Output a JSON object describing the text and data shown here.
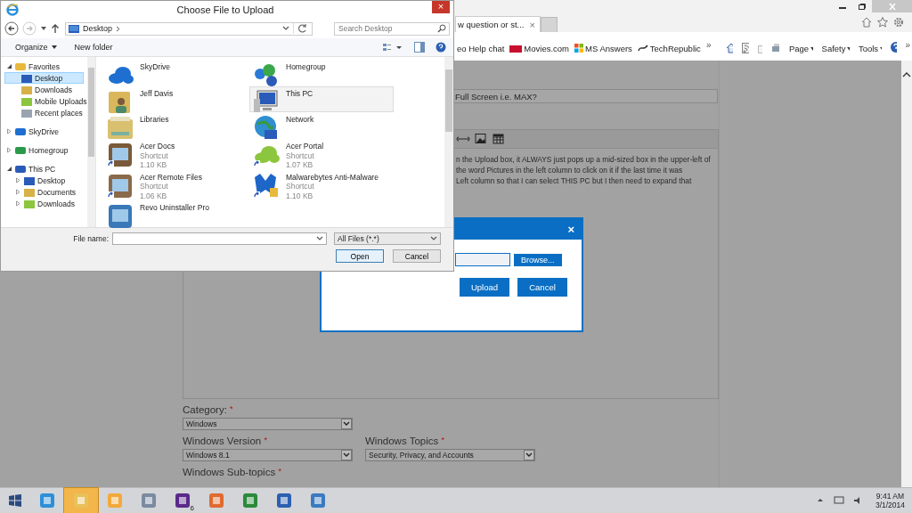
{
  "browser": {
    "tab": {
      "title": "w question or st...",
      "close": "×"
    },
    "favorites": [
      "eo Help chat",
      "Movies.com",
      "MS Answers",
      "TechRepublic"
    ],
    "overflow": "»",
    "commands": [
      "Page",
      "Safety",
      "Tools"
    ],
    "end_overflow": "»"
  },
  "page": {
    "title_value": "Full Screen i.e. MAX?",
    "body_lines": [
      "n the Upload box, it ALWAYS just pops up a mid-sized box in the upper-left of",
      "the word Pictures in the left column to click on it if the last time it was",
      "Left column so that I can select THIS PC but I then need to expand that"
    ],
    "category": {
      "label": "Category:",
      "required": "*",
      "value": "Windows"
    },
    "version": {
      "label": "Windows Version",
      "required": "*",
      "value": "Windows 8.1"
    },
    "topics": {
      "label": "Windows Topics",
      "required": "*",
      "value": "Security, Privacy, and Accounts"
    },
    "subtopics": {
      "label": "Windows Sub-topics",
      "required": "*"
    }
  },
  "upload_dialog": {
    "close": "×",
    "browse": "Browse...",
    "buttons": [
      "Upload",
      "Cancel"
    ]
  },
  "file_dialog": {
    "title": "Choose File to Upload",
    "close": "×",
    "address": "Desktop",
    "search": {
      "placeholder": "Search Desktop"
    },
    "toolbar": [
      "Organize",
      "New folder"
    ],
    "nav": [
      {
        "label": "Favorites",
        "expanded": true,
        "selected": false,
        "children": [
          {
            "label": "Desktop",
            "selected": true
          },
          {
            "label": "Downloads",
            "selected": false
          },
          {
            "label": "Mobile Uploads",
            "selected": false
          },
          {
            "label": "Recent places",
            "selected": false
          }
        ]
      },
      {
        "label": "SkyDrive",
        "expanded": false,
        "selected": false
      },
      {
        "label": "Homegroup",
        "expanded": false,
        "selected": false
      },
      {
        "label": "This PC",
        "expanded": true,
        "selected": false,
        "children": [
          {
            "label": "Desktop",
            "selected": false
          },
          {
            "label": "Documents",
            "selected": false
          },
          {
            "label": "Downloads",
            "selected": false
          }
        ]
      }
    ],
    "files": [
      {
        "name": "SkyDrive",
        "selected": false
      },
      {
        "name": "Homegroup",
        "selected": false
      },
      {
        "name": "Jeff Davis",
        "selected": false
      },
      {
        "name": "This PC",
        "selected": true
      },
      {
        "name": "Libraries",
        "selected": false
      },
      {
        "name": "Network",
        "selected": false
      },
      {
        "name": "Acer Docs",
        "type": "Shortcut",
        "size": "1.10 KB",
        "selected": false
      },
      {
        "name": "Acer Portal",
        "type": "Shortcut",
        "size": "1.07 KB",
        "selected": false
      },
      {
        "name": "Acer Remote Files",
        "type": "Shortcut",
        "size": "1.06 KB",
        "selected": false
      },
      {
        "name": "Malwarebytes Anti-Malware",
        "type": "Shortcut",
        "size": "1.10 KB",
        "selected": false
      },
      {
        "name": "Revo Uninstaller Pro",
        "selected": false
      }
    ],
    "file_name_label": "File name:",
    "filter": "All Files (*.*)",
    "buttons": [
      {
        "label": "Open",
        "default": true
      },
      {
        "label": "Cancel",
        "default": false
      }
    ]
  },
  "taskbar": {
    "items": [
      {
        "active": false
      },
      {
        "active": true
      },
      {
        "active": false
      },
      {
        "active": false
      },
      {
        "active": false,
        "badge": "6"
      },
      {
        "active": false
      },
      {
        "active": false
      },
      {
        "active": false
      },
      {
        "active": false
      }
    ],
    "time": "9:41 AM",
    "date": "3/1/2014"
  }
}
